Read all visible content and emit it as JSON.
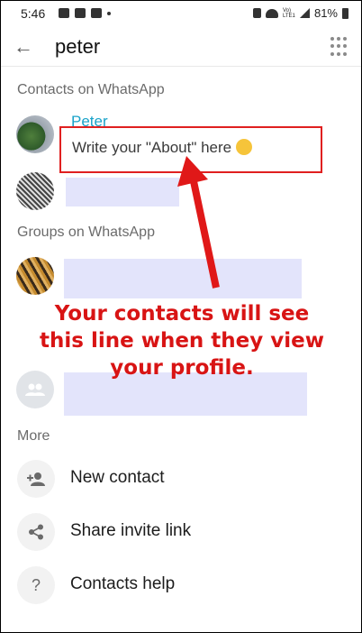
{
  "status_bar": {
    "time": "5:46",
    "network": "Vo) LTE1",
    "battery": "81%"
  },
  "search": {
    "query": "peter"
  },
  "sections": {
    "contacts_header": "Contacts on WhatsApp",
    "groups_header": "Groups on WhatsApp",
    "more_header": "More"
  },
  "contact": {
    "name": "Peter",
    "about_placeholder": "Write your \"About\" here"
  },
  "annotation": {
    "line1": "Your contacts will see",
    "line2": "this line when they view",
    "line3": "your profile."
  },
  "more_items": [
    {
      "label": "New contact",
      "icon": "add-person-icon"
    },
    {
      "label": "Share invite link",
      "icon": "share-icon"
    },
    {
      "label": "Contacts help",
      "icon": "help-icon"
    }
  ],
  "colors": {
    "accent_name": "#1aa3c9",
    "annotation_red": "#d81414",
    "blurred": "#e3e4fb"
  }
}
